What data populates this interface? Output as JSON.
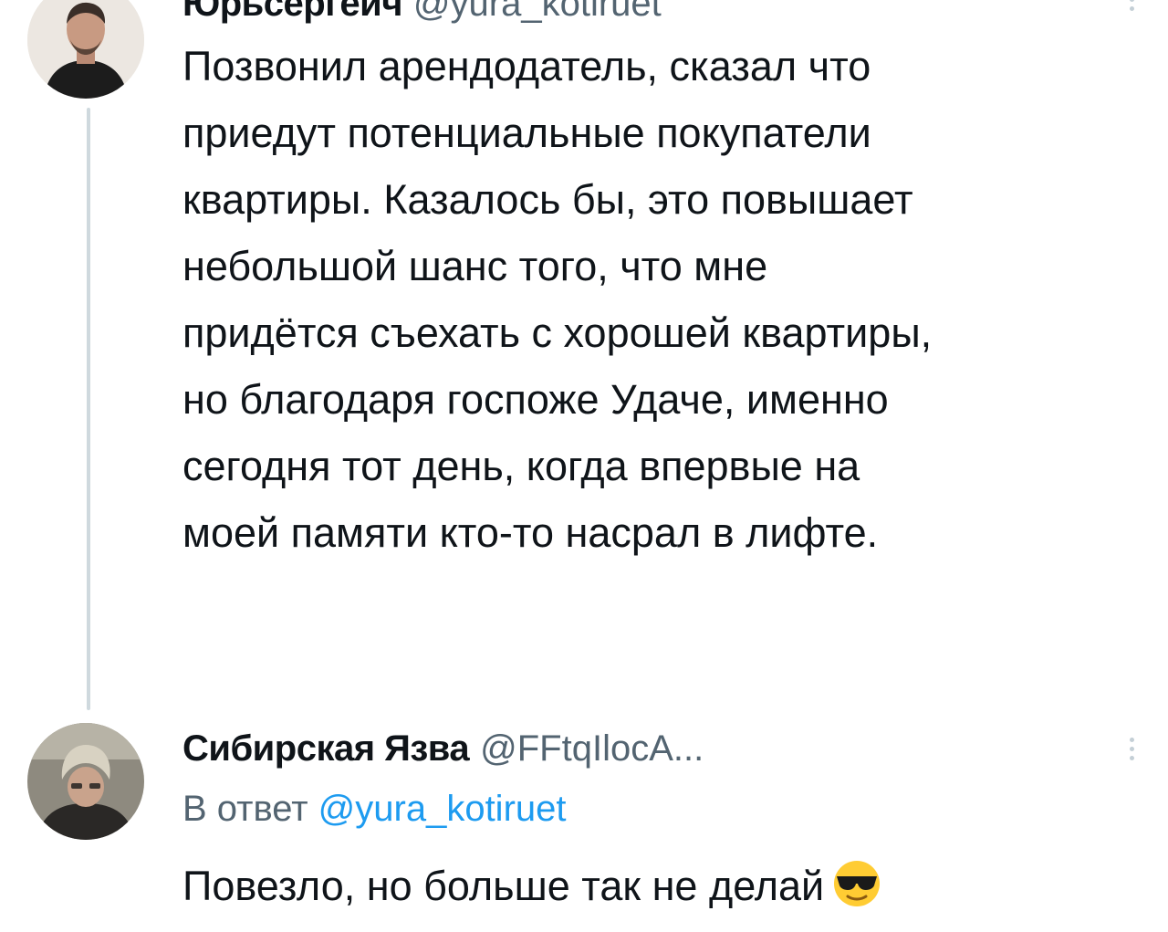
{
  "tweet1": {
    "display_name": "Юрьсергейч",
    "handle": "@yura_kotiruet",
    "body_lines": [
      "Позвонил арендодатель, сказал что",
      "приедут потенциальные покупатели",
      "квартиры. Казалось бы, это повышает",
      "небольшой шанс того, что мне",
      "придётся съехать с хорошей квартиры,",
      "но благодаря госпоже Удаче, именно",
      "сегодня тот день, когда впервые на",
      "моей памяти кто-то насрал в лифте."
    ]
  },
  "tweet2": {
    "display_name": "Сибирская Язва",
    "handle": "@FFtqIlocA...",
    "reply_prefix": "В ответ",
    "reply_mention": "@yura_kotiruet",
    "body": "Повезло, но больше так не делай",
    "emoji": "sunglasses-emoji"
  },
  "colors": {
    "text": "#0f1419",
    "secondary": "#536471",
    "link": "#1d9bf0",
    "thread_line": "#cfd9de"
  }
}
